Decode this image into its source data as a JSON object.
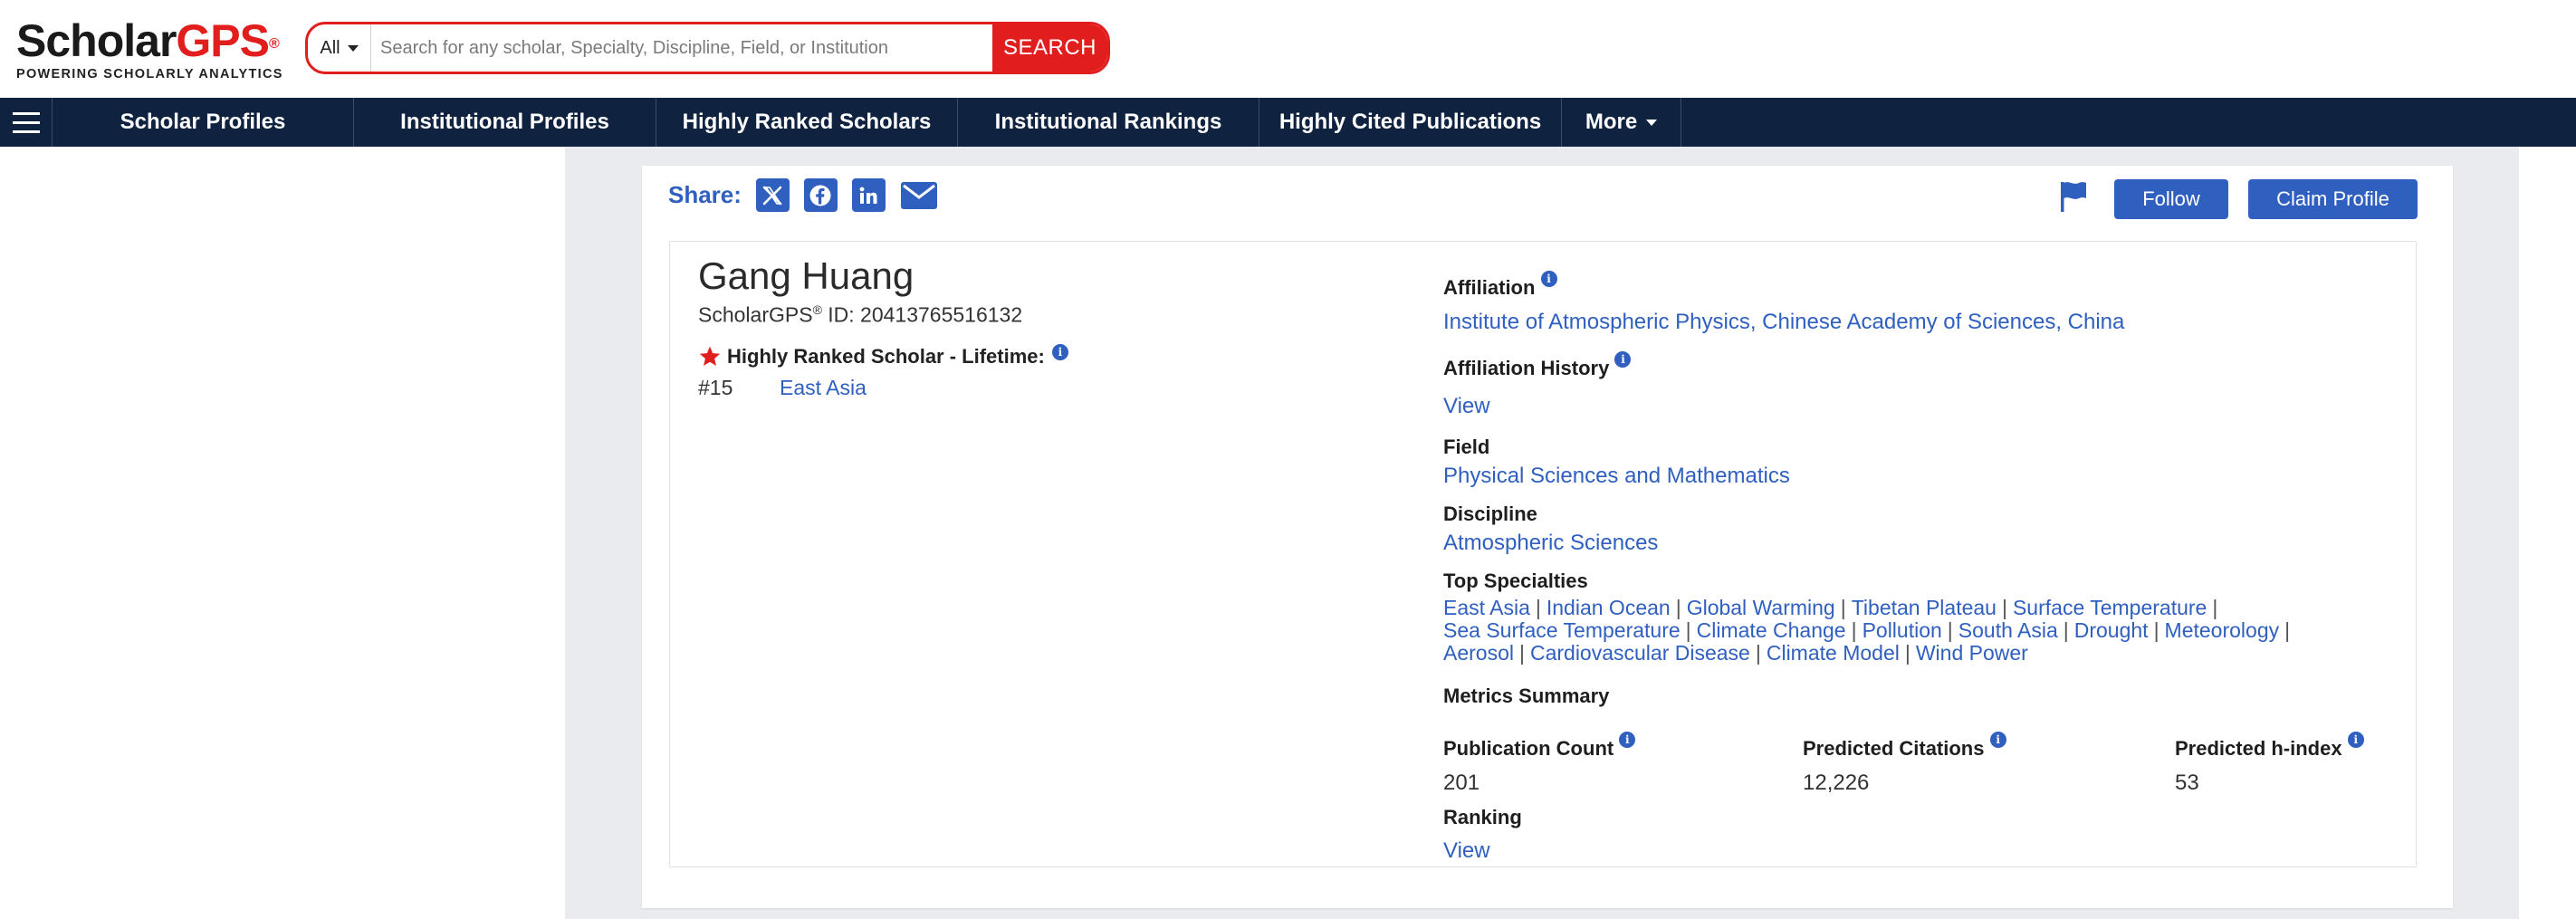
{
  "logo": {
    "word1": "Scholar",
    "word2": "GPS",
    "mark": "®",
    "tagline": "POWERING SCHOLARLY ANALYTICS"
  },
  "search": {
    "type_value": "All",
    "placeholder": "Search for any scholar, Specialty, Discipline, Field, or Institution",
    "button_label": "SEARCH"
  },
  "nav": {
    "menu_icon": "hamburger-icon",
    "items": [
      "Scholar Profiles",
      "Institutional Profiles",
      "Highly Ranked Scholars",
      "Institutional Rankings",
      "Highly Cited Publications",
      "More"
    ]
  },
  "share": {
    "label": "Share:",
    "icons": [
      "x-twitter-icon",
      "facebook-icon",
      "linkedin-icon",
      "envelope-icon"
    ]
  },
  "actions": {
    "flag_icon": "flag-icon",
    "follow_label": "Follow",
    "claim_label": "Claim Profile"
  },
  "profile": {
    "name": "Gang Huang",
    "id_prefix": "ScholarGPS",
    "id_mark": "®",
    "id_text": " ID: 20413765516132",
    "highly_ranked_label": "Highly Ranked Scholar - Lifetime:",
    "rank_number": "#15",
    "rank_region": "East Asia"
  },
  "details": {
    "affiliation_label": "Affiliation",
    "affiliation_value": "Institute of Atmospheric Physics, Chinese Academy of Sciences, China",
    "affiliation_history_label": "Affiliation History",
    "affiliation_history_link": "View",
    "field_label": "Field",
    "field_value": "Physical Sciences and Mathematics",
    "discipline_label": "Discipline",
    "discipline_value": "Atmospheric Sciences",
    "top_specialties_label": "Top Specialties",
    "specialties": [
      "East Asia",
      "Indian Ocean",
      "Global Warming",
      "Tibetan Plateau",
      "Surface Temperature",
      "Sea Surface Temperature",
      "Climate Change",
      "Pollution",
      "South Asia",
      "Drought",
      "Meteorology",
      "Aerosol",
      "Cardiovascular Disease",
      "Climate Model",
      "Wind Power"
    ],
    "metrics_summary_label": "Metrics Summary",
    "publication_count_label": "Publication Count",
    "publication_count_value": "201",
    "predicted_citations_label": "Predicted Citations",
    "predicted_citations_value": "12,226",
    "predicted_hindex_label": "Predicted h-index",
    "predicted_hindex_value": "53",
    "ranking_label": "Ranking",
    "ranking_link": "View"
  },
  "colors": {
    "brand_red": "#e21d1d",
    "nav_navy": "#0f2240",
    "link_blue": "#2f5fbf",
    "page_gray": "#eaebef"
  }
}
